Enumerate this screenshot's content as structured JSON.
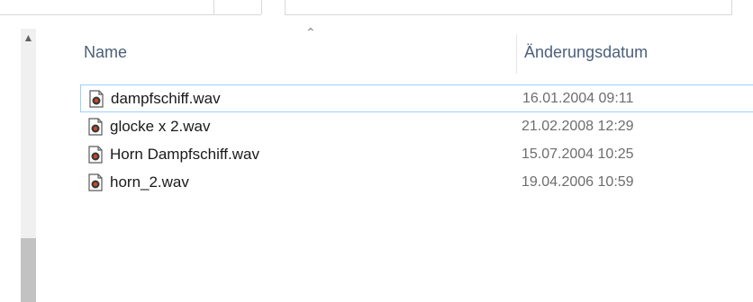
{
  "header": {
    "name_label": "Name",
    "date_label": "Änderungsdatum"
  },
  "files": [
    {
      "name": "dampfschiff.wav",
      "date": "16.01.2004 09:11",
      "icon": "audio-file-icon"
    },
    {
      "name": "glocke x 2.wav",
      "date": "21.02.2008 12:29",
      "icon": "audio-file-icon"
    },
    {
      "name": "Horn Dampfschiff.wav",
      "date": "15.07.2004 10:25",
      "icon": "audio-file-icon"
    },
    {
      "name": "horn_2.wav",
      "date": "19.04.2006 10:59",
      "icon": "audio-file-icon"
    }
  ],
  "colors": {
    "header_text": "#4c607a",
    "focus_border": "#99d1ff",
    "scrollbar_thumb": "#c2c2c2"
  }
}
